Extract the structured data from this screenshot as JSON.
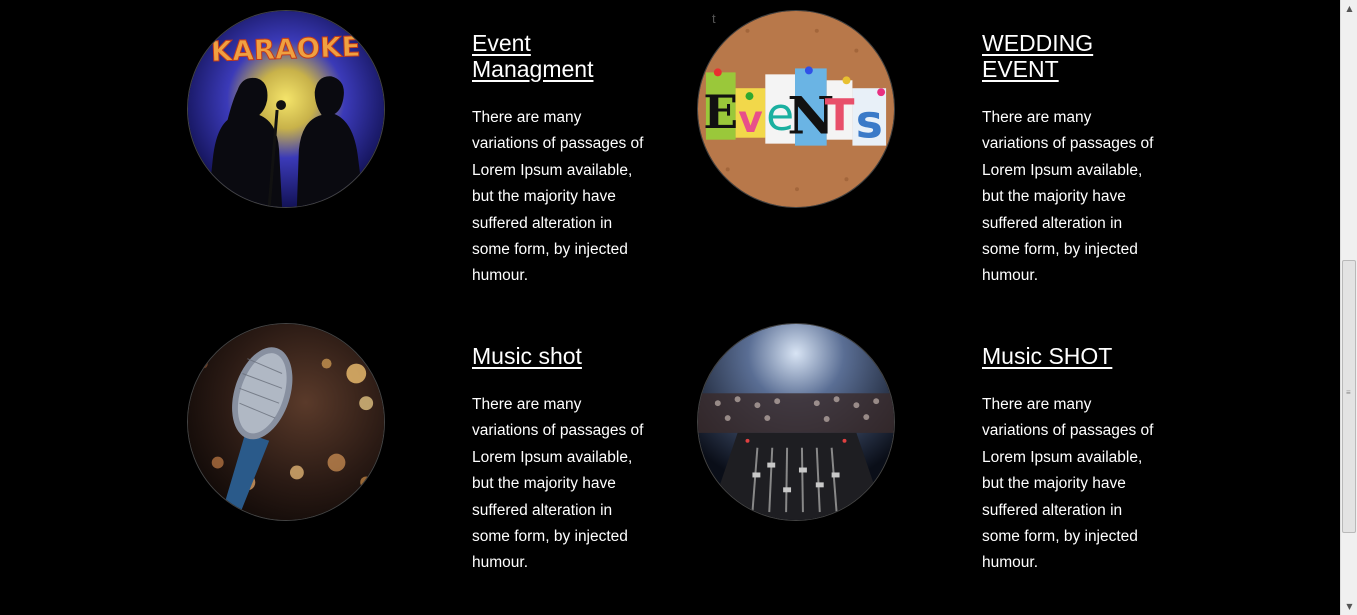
{
  "stray_char": "t",
  "cards": [
    {
      "title": "Event Managment",
      "body": "There are many variations of passages of Lorem Ipsum available, but the majority have suffered alteration in some form, by injected humour.",
      "image_text": "KARAOKE"
    },
    {
      "title": "WEDDING EVENT",
      "body": "There are many variations of passages of Lorem Ipsum available, but the majority have suffered alteration in some form, by injected humour.",
      "image_letters": [
        "E",
        "v",
        "e",
        "N",
        "T",
        "s"
      ]
    },
    {
      "title": "Music shot",
      "body": "There are many variations of passages of Lorem Ipsum available, but the majority have suffered alteration in some form, by injected humour."
    },
    {
      "title": "Music SHOT",
      "body": "There are many variations of passages of Lorem Ipsum available, but the majority have suffered alteration in some form, by injected humour."
    }
  ],
  "scrollbar": {
    "up_icon": "triangle-up",
    "down_icon": "triangle-down"
  }
}
